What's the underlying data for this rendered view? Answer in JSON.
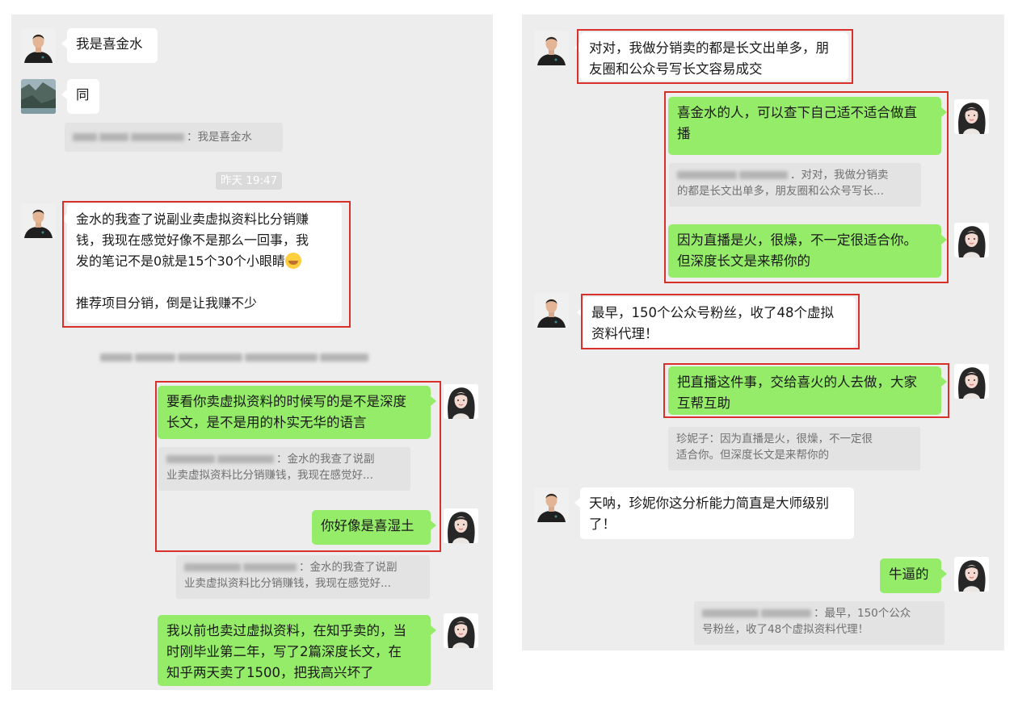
{
  "left": {
    "m1": {
      "text": "我是喜金水"
    },
    "m2": {
      "text": "同"
    },
    "q1": {
      "text": "：我是喜金水"
    },
    "time": "昨天 19:47",
    "m3": {
      "line1": "金水的我查了说副业卖虚拟资料比分销赚",
      "line2": "钱，我现在感觉好像不是那么一回事，我",
      "line3": "发的笔记不是0就是15个30个小眼睛",
      "line4": "推荐项目分销，倒是让我赚不少"
    },
    "m4": {
      "line1": "要看你卖虚拟资料的时候写的是不是深度",
      "line2": "长文，是不是用的朴实无华的语言"
    },
    "q2": {
      "line1": "：金水的我查了说副",
      "line2": "业卖虚拟资料比分销赚钱，我现在感觉好..."
    },
    "m5": {
      "text": "你好像是喜湿土"
    },
    "q3": {
      "line1": "：金水的我查了说副",
      "line2": "业卖虚拟资料比分销赚钱，我现在感觉好..."
    },
    "m6": {
      "line1": "我以前也卖过虚拟资料，在知乎卖的，当",
      "line2": "时刚毕业第二年，写了2篇深度长文，在",
      "line3": "知乎两天卖了1500，把我高兴坏了"
    }
  },
  "right": {
    "m1": {
      "line1": "对对，我做分销卖的都是长文出单多，朋",
      "line2": "友圈和公众号写长文容易成交"
    },
    "m2": {
      "line1": "喜金水的人，可以查下自己适不适合做直",
      "line2": "播"
    },
    "q1": {
      "line1": "．对对，我做分销卖",
      "line2": "的都是长文出单多，朋友圈和公众号写长..."
    },
    "m3": {
      "line1": "因为直播是火，很燥，不一定很适合你。",
      "line2": "但深度长文是来帮你的"
    },
    "m4": {
      "line1": "最早，150个公众号粉丝，收了48个虚拟",
      "line2": "资料代理！"
    },
    "m5": {
      "line1": "把直播这件事，交给喜火的人去做，大家",
      "line2": "互帮互助"
    },
    "q2": {
      "line1": "珍妮子：因为直播是火，很燥，不一定很",
      "line2": "适合你。但深度长文是来帮你的"
    },
    "m6": {
      "line1": "天呐，珍妮你这分析能力简直是大师级别",
      "line2": "了！"
    },
    "m7": {
      "text": "牛逼的"
    },
    "q3": {
      "line1": "：最早，150个公众",
      "line2": "号粉丝，收了48个虚拟资料代理！"
    }
  },
  "colors": {
    "chat_bg": "#ededed",
    "bubble_out": "#95ec69",
    "bubble_in": "#ffffff",
    "highlight_box": "#d9302b"
  },
  "icons": {
    "avatar_man": "man-avatar-icon",
    "avatar_landscape": "landscape-avatar-icon",
    "avatar_woman": "woman-avatar-icon",
    "emoji": "facepalm-emoji-icon"
  }
}
